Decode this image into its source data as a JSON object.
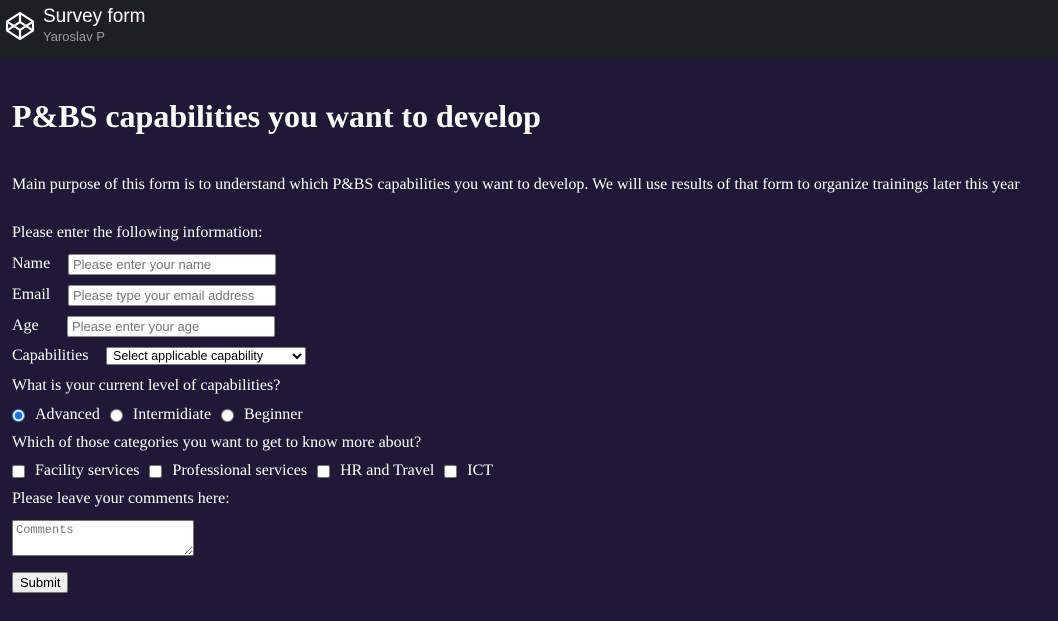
{
  "topbar": {
    "logo_icon": "codepen-cube-icon",
    "title": "Survey form",
    "author": "Yaroslav P"
  },
  "form": {
    "heading": "P&BS capabilities you want to develop",
    "description": "Main purpose of this form is to understand which P&BS capabilities you want to develop. We will use results of that form to organize trainings later this year",
    "intro": "Please enter the following information:",
    "name": {
      "label": "Name",
      "placeholder": "Please enter your name",
      "value": ""
    },
    "email": {
      "label": "Email",
      "placeholder": "Please type your email address",
      "value": ""
    },
    "age": {
      "label": "Age",
      "placeholder": "Please enter your age",
      "value": ""
    },
    "capabilities": {
      "label": "Capabilities",
      "selected": "Select applicable capability"
    },
    "level_question": "What is your current level of capabilities?",
    "levels": [
      {
        "label": "Advanced",
        "checked": true
      },
      {
        "label": "Intermidiate",
        "checked": false
      },
      {
        "label": "Beginner",
        "checked": false
      }
    ],
    "categories_question": "Which of those categories you want to get to know more about?",
    "categories": [
      {
        "label": "Facility services",
        "checked": false
      },
      {
        "label": "Professional services",
        "checked": false
      },
      {
        "label": "HR and Travel",
        "checked": false
      },
      {
        "label": "ICT",
        "checked": false
      }
    ],
    "comments_label": "Please leave your comments here:",
    "comments_placeholder": "Comments",
    "submit_label": "Submit"
  },
  "colors": {
    "page_background": "#1f1937",
    "topbar_background": "#1e1f22",
    "text": "#ffffff",
    "radio_accent": "#1a73e8"
  }
}
